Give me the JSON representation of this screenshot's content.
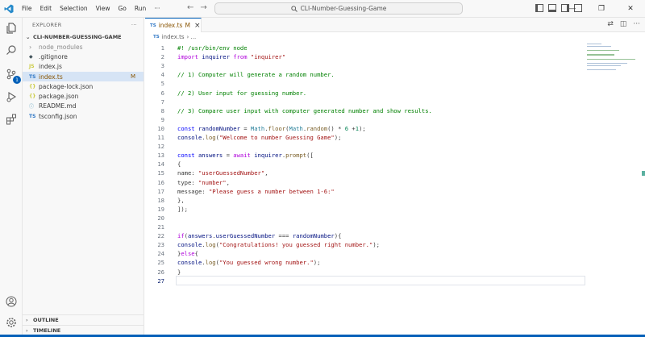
{
  "titlebar": {
    "menu": [
      "File",
      "Edit",
      "Selection",
      "View",
      "Go",
      "Run",
      "···"
    ],
    "search_text": "CLI-Number-Guessing-Game"
  },
  "activity": {
    "icons": [
      "explorer-icon",
      "search-icon",
      "source-control-icon",
      "run-debug-icon",
      "extensions-icon"
    ],
    "scm_badge": "1"
  },
  "sidebar": {
    "title": "EXPLORER",
    "more": "···",
    "folder": "CLI-NUMBER-GUESSING-GAME",
    "files": [
      {
        "icon": "›",
        "name": "node_modules",
        "mod": ""
      },
      {
        "icon": "◆",
        "name": ".gitignore",
        "mod": ""
      },
      {
        "icon": "JS",
        "name": "index.js",
        "mod": ""
      },
      {
        "icon": "TS",
        "name": "index.ts",
        "mod": "M"
      },
      {
        "icon": "{}",
        "name": "package-lock.json",
        "mod": ""
      },
      {
        "icon": "{}",
        "name": "package.json",
        "mod": ""
      },
      {
        "icon": "ⓘ",
        "name": "README.md",
        "mod": ""
      },
      {
        "icon": "TS",
        "name": "tsconfig.json",
        "mod": ""
      }
    ],
    "outline": "OUTLINE",
    "timeline": "TIMELINE"
  },
  "editor": {
    "tab_icon": "TS",
    "tab_name": "index.ts",
    "tab_mod": "M",
    "tab_close": "×",
    "breadcrumb_icon": "TS",
    "breadcrumb_file": "index.ts",
    "breadcrumb_rest": "› ...",
    "lines": [
      "#! /usr/bin/env node",
      "import inquirer from \"inquirer\"",
      "",
      "// 1) Computer will generate a random number.",
      "",
      "// 2) User input for guessing number.",
      "",
      "// 3) Compare user input with computer generated number and show results.",
      "",
      "const randomNumber = Math.floor(Math.random() * 6 +1);",
      "console.log(\"Welcome to number Guessing Game\");",
      "",
      "const answers = await inquirer.prompt([",
      "{",
      "name: \"userGuessedNumber\",",
      "type: \"number\",",
      "message: \"Please guess a number between 1-6:\"",
      "},",
      "]);",
      "",
      "",
      "if(answers.userGuessedNumber === randomNumber){",
      "console.log(\"Congratulations! you guessed right number.\");",
      "}else{",
      "console.log(\"You guessed wrong number.\");",
      "}",
      ""
    ]
  },
  "colors": {
    "accent": "#005fb8",
    "keyword": "#af00db",
    "string": "#a31515",
    "comment": "#008000"
  }
}
